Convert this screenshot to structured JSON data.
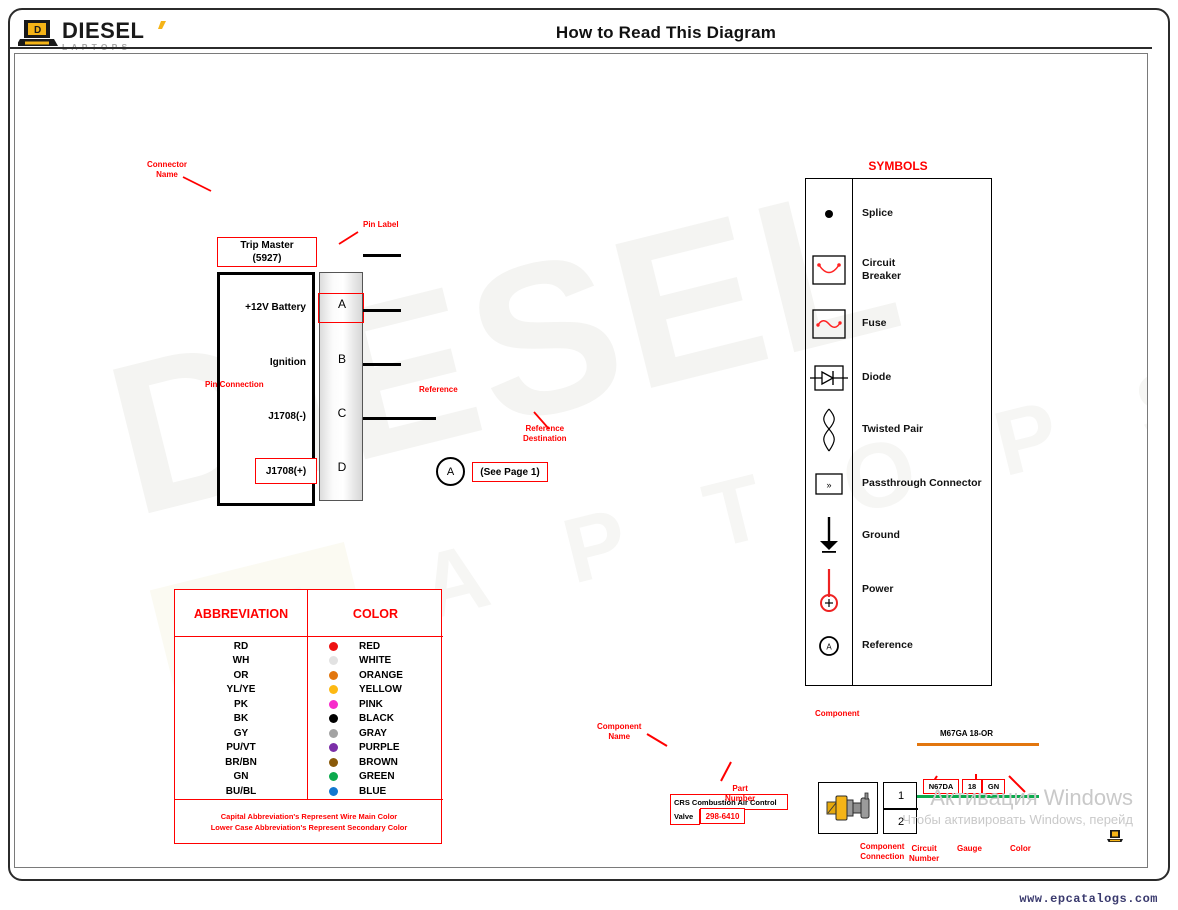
{
  "header": {
    "title": "How to Read This Diagram",
    "logo_main": "DIESEL",
    "logo_sub": "L A P T O P S"
  },
  "watermark": {
    "brand_big": "DIESEL",
    "brand_small": "L A P T O P S",
    "windows_line1": "Активация Windows",
    "windows_line2": "Чтобы активировать Windows, перейд"
  },
  "footer": {
    "url": "www.epcatalogs.com"
  },
  "connector": {
    "annotations": {
      "connector_name": "Connector\nName",
      "connector_name_l1": "Connector",
      "connector_name_l2": "Name",
      "pin_label": "Pin Label",
      "pin_connection": "Pin Connection",
      "reference": "Reference",
      "reference_destination_l1": "Reference",
      "reference_destination_l2": "Destination"
    },
    "name_line1": "Trip Master",
    "name_line2": "(5927)",
    "pins": [
      {
        "function": "+12V Battery",
        "label": "A"
      },
      {
        "function": "Ignition",
        "label": "B"
      },
      {
        "function": "J1708(-)",
        "label": "C"
      },
      {
        "function": "J1708(+)",
        "label": "D"
      }
    ],
    "reference_letter": "A",
    "reference_destination": "(See Page 1)"
  },
  "symbols": {
    "title": "SYMBOLS",
    "items": [
      {
        "icon": "splice-icon",
        "label": "Splice"
      },
      {
        "icon": "circuit-breaker-icon",
        "label": "Circuit\nBreaker",
        "label_l1": "Circuit",
        "label_l2": "Breaker"
      },
      {
        "icon": "fuse-icon",
        "label": "Fuse"
      },
      {
        "icon": "diode-icon",
        "label": "Diode"
      },
      {
        "icon": "twisted-pair-icon",
        "label": "Twisted Pair"
      },
      {
        "icon": "passthrough-connector-icon",
        "label": "Passthrough Connector"
      },
      {
        "icon": "ground-icon",
        "label": "Ground"
      },
      {
        "icon": "power-icon",
        "label": "Power"
      },
      {
        "icon": "reference-icon",
        "label": "Reference"
      }
    ]
  },
  "abbreviation_table": {
    "headers": [
      "ABBREVIATION",
      "COLOR"
    ],
    "rows": [
      {
        "code": "RD",
        "color_name": "RED",
        "hex": "#ee1111"
      },
      {
        "code": "WH",
        "color_name": "WHITE",
        "hex": "#e2e2e2"
      },
      {
        "code": "OR",
        "color_name": "ORANGE",
        "hex": "#e2760e"
      },
      {
        "code": "YL/YE",
        "color_name": "YELLOW",
        "hex": "#fdb913"
      },
      {
        "code": "PK",
        "color_name": "PINK",
        "hex": "#f72bcb"
      },
      {
        "code": "BK",
        "color_name": "BLACK",
        "hex": "#000000"
      },
      {
        "code": "GY",
        "color_name": "GRAY",
        "hex": "#a3a3a3"
      },
      {
        "code": "PU/VT",
        "color_name": "PURPLE",
        "hex": "#7b2fa8"
      },
      {
        "code": "BR/BN",
        "color_name": "BROWN",
        "hex": "#8a5a0a"
      },
      {
        "code": "GN",
        "color_name": "GREEN",
        "hex": "#0caa4d"
      },
      {
        "code": "BU/BL",
        "color_name": "BLUE",
        "hex": "#1277cf"
      }
    ],
    "note_line1": "Capital Abbreviation's Represent Wire Main Color",
    "note_line2": "Lower Case Abbreviation's Represent Secondary Color"
  },
  "component_example": {
    "annotations": {
      "component_name_l1": "Component",
      "component_name_l2": "Name",
      "part_number_l1": "Part",
      "part_number_l2": "Number",
      "component": "Component",
      "component_connection_l1": "Component",
      "component_connection_l2": "Connection",
      "circuit_number_l1": "Circuit",
      "circuit_number_l2": "Number",
      "gauge": "Gauge",
      "color": "Color"
    },
    "name": "CRS Combustion Air Control",
    "name_line2": "Valve",
    "part_number": "298-6410",
    "pins": [
      "1",
      "2"
    ],
    "wire_top": {
      "label": "M67GA 18-OR",
      "hex": "#e2760e"
    },
    "wire_bottom": {
      "circuit_number": "N67DA",
      "gauge": "18",
      "color_code": "GN",
      "hex": "#0caa4d"
    }
  }
}
